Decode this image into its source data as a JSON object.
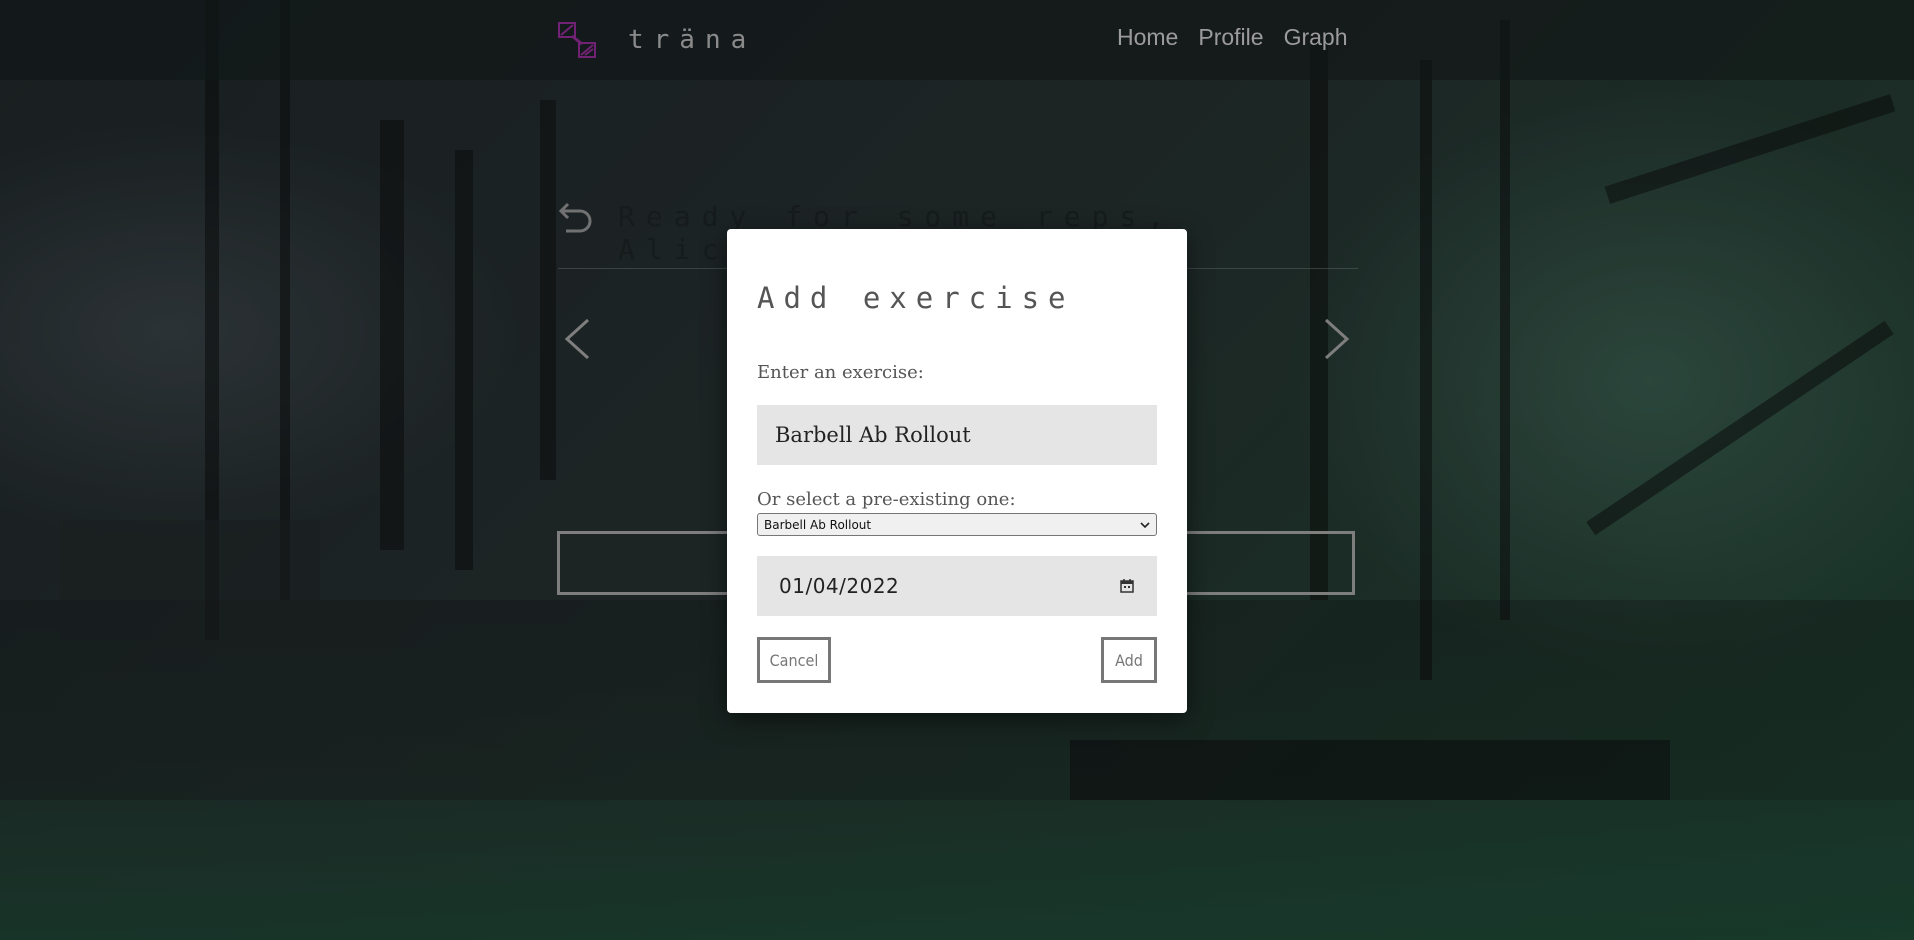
{
  "brand": {
    "name": "träna"
  },
  "nav": {
    "items": [
      "Home",
      "Profile",
      "Graph"
    ]
  },
  "page": {
    "greeting": "Ready for some reps, Alice?"
  },
  "modal": {
    "title": "Add exercise",
    "exercise_label": "Enter an exercise:",
    "exercise_value": "Barbell Ab Rollout",
    "select_label": "Or select a pre-existing one:",
    "select_value": "Barbell Ab Rollout",
    "date_value": "01/04/2022",
    "cancel_label": "Cancel",
    "add_label": "Add"
  },
  "colors": {
    "brand_accent": "#8a2a8f",
    "modal_bg": "#ffffff",
    "field_bg": "#e5e5e5"
  }
}
